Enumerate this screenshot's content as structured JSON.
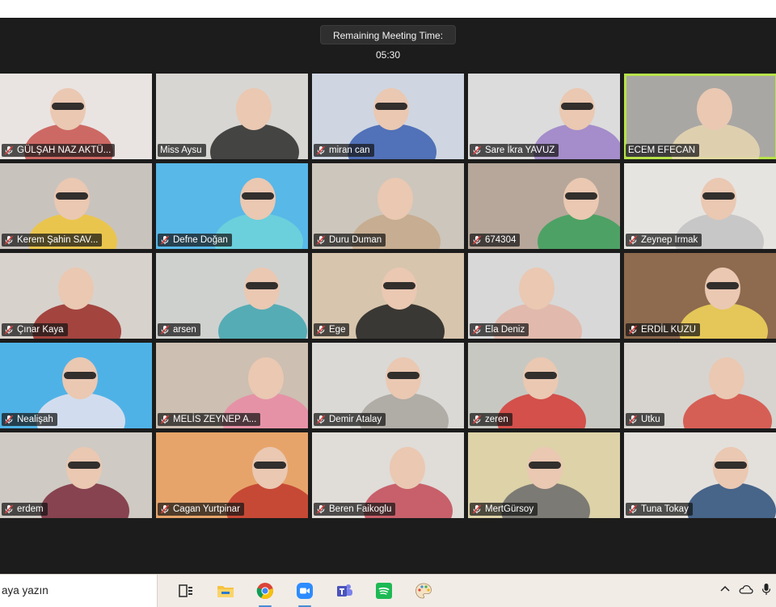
{
  "meeting": {
    "remaining_time": "Remaining Meeting Time: 05:30"
  },
  "participants": [
    {
      "name": "GÜLŞAH NAZ AKTÜ...",
      "muted": true,
      "bg": "#e9e4e2",
      "accent": "#c8544d",
      "active": false
    },
    {
      "name": "Miss Aysu",
      "muted": false,
      "bg": "#d8d6d2",
      "accent": "#2a2a2a",
      "active": false
    },
    {
      "name": "miran can",
      "muted": true,
      "bg": "#cfd6e2",
      "accent": "#3b5fb0",
      "active": false
    },
    {
      "name": "Sare İkra YAVUZ",
      "muted": true,
      "bg": "#dcdcdc",
      "accent": "#9a7fc7",
      "active": false
    },
    {
      "name": "ECEM EFECAN",
      "muted": false,
      "bg": "#a9a7a4",
      "accent": "#e8d7b2",
      "active": true
    },
    {
      "name": "Kerem Şahin SAV...",
      "muted": true,
      "bg": "#c9c3be",
      "accent": "#f0c53a",
      "active": false
    },
    {
      "name": "Defne Doğan",
      "muted": true,
      "bg": "#58b8e8",
      "accent": "#6fd2d9",
      "active": false
    },
    {
      "name": "Duru Duman",
      "muted": true,
      "bg": "#cdc6bc",
      "accent": "#c6a88a",
      "active": false
    },
    {
      "name": "674304",
      "muted": true,
      "bg": "#b6a79a",
      "accent": "#3ba05b",
      "active": false
    },
    {
      "name": "Zeynep Irmak",
      "muted": true,
      "bg": "#e6e4e1",
      "accent": "#c2c2c2",
      "active": false
    },
    {
      "name": "Çınar Kaya",
      "muted": true,
      "bg": "#d8d2cc",
      "accent": "#9a2c26",
      "active": false
    },
    {
      "name": "arsen",
      "muted": true,
      "bg": "#cfd1cf",
      "accent": "#3fa6b0",
      "active": false
    },
    {
      "name": "Ege",
      "muted": true,
      "bg": "#d7c5ad",
      "accent": "#1f1f1f",
      "active": false
    },
    {
      "name": "Ela Deniz",
      "muted": true,
      "bg": "#d8d8d8",
      "accent": "#e3b5a6",
      "active": false
    },
    {
      "name": "ERDİL KUZU",
      "muted": true,
      "bg": "#8e6a4e",
      "accent": "#f3d75b",
      "active": false
    },
    {
      "name": "Nealişah",
      "muted": true,
      "bg": "#4fb2e6",
      "accent": "#e7e4ef",
      "active": false
    },
    {
      "name": "MELİS ZEYNEP A...",
      "muted": true,
      "bg": "#cdbfb1",
      "accent": "#e98aa6",
      "active": false
    },
    {
      "name": "Demir Atalay",
      "muted": true,
      "bg": "#dad9d6",
      "accent": "#a8a39e",
      "active": false
    },
    {
      "name": "zeren",
      "muted": true,
      "bg": "#c8c8c2",
      "accent": "#d53b36",
      "active": false
    },
    {
      "name": "Utku",
      "muted": true,
      "bg": "#d7d4d0",
      "accent": "#d64a3f",
      "active": false
    },
    {
      "name": "erdem",
      "muted": true,
      "bg": "#cfcac3",
      "accent": "#7a2c3c",
      "active": false
    },
    {
      "name": "Cagan Yurtpinar",
      "muted": true,
      "bg": "#e7a46a",
      "accent": "#c0392b",
      "active": false
    },
    {
      "name": "Beren Faikoglu",
      "muted": true,
      "bg": "#e0dcd8",
      "accent": "#c24a57",
      "active": false
    },
    {
      "name": "MertGürsoy",
      "muted": true,
      "bg": "#ddd2a8",
      "accent": "#6b6b6b",
      "active": false
    },
    {
      "name": "Tuna Tokay",
      "muted": true,
      "bg": "#e3e0dc",
      "accent": "#2c4d7a",
      "active": false
    }
  ],
  "taskbar": {
    "search_text": "aya yazın",
    "apps": [
      {
        "icon": "task-view-icon",
        "open": false
      },
      {
        "icon": "file-explorer-icon",
        "open": false
      },
      {
        "icon": "chrome-icon",
        "open": true
      },
      {
        "icon": "zoom-icon",
        "open": true
      },
      {
        "icon": "teams-icon",
        "open": false
      },
      {
        "icon": "spotify-icon",
        "open": false
      },
      {
        "icon": "paint-icon",
        "open": false
      }
    ],
    "tray": [
      {
        "icon": "chevron-up-icon"
      },
      {
        "icon": "onedrive-cloud-icon"
      },
      {
        "icon": "microphone-icon"
      }
    ]
  }
}
